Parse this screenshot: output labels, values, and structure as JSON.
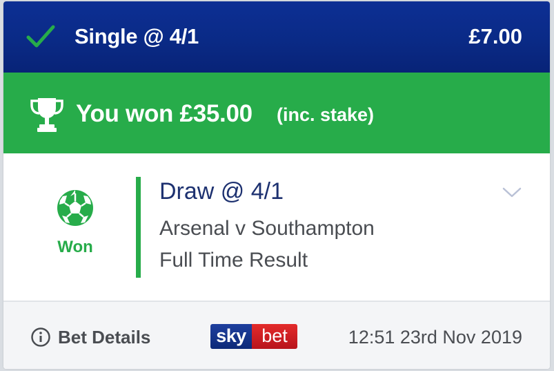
{
  "header": {
    "title": "Single @ 4/1",
    "stake": "£7.00"
  },
  "win_banner": {
    "amount": "You won £35.00",
    "note": "(inc. stake)"
  },
  "selection": {
    "status": "Won",
    "title": "Draw @ 4/1",
    "event": "Arsenal v Southampton",
    "market": "Full Time Result"
  },
  "footer": {
    "details_label": "Bet Details",
    "logo": {
      "sky": "sky",
      "bet": "bet"
    },
    "timestamp": "12:51 23rd Nov 2019"
  },
  "icons": {
    "status": "check-icon",
    "banner": "trophy-icon",
    "sport": "football-icon",
    "expand": "chevron-down-icon",
    "info": "info-icon"
  },
  "colors": {
    "header_bg": "#0a2a86",
    "win_green": "#27ac4a",
    "title_navy": "#1d3170",
    "text_gray": "#4a4d52",
    "footer_bg": "#f4f5f7",
    "logo_red": "#d0212a"
  }
}
